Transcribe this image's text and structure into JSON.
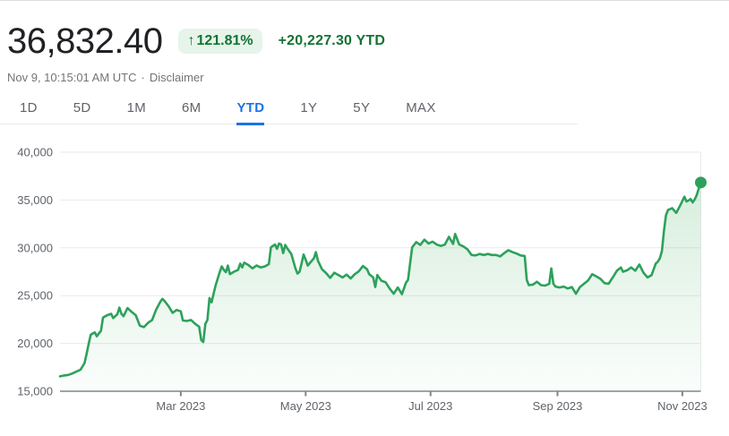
{
  "header": {
    "price": "36,832.40",
    "change_badge": {
      "arrow_icon": "↑",
      "percent": "121.81%"
    },
    "change_absolute": "+20,227.30 YTD",
    "timestamp": "Nov 9, 10:15:01 AM UTC",
    "separator": "·",
    "disclaimer_label": "Disclaimer"
  },
  "tabs": {
    "items": [
      {
        "label": "1D",
        "active": false
      },
      {
        "label": "5D",
        "active": false
      },
      {
        "label": "1M",
        "active": false
      },
      {
        "label": "6M",
        "active": false
      },
      {
        "label": "YTD",
        "active": true
      },
      {
        "label": "1Y",
        "active": false
      },
      {
        "label": "5Y",
        "active": false
      },
      {
        "label": "MAX",
        "active": false
      }
    ]
  },
  "colors": {
    "line_green": "#2da15b",
    "fill_green": "#34a853",
    "green_dark": "#137333",
    "badge_bg": "#e6f4ea",
    "blue": "#1a73e8",
    "grid": "#e8eaed",
    "axis": "#80868b",
    "tick_label": "#5f6368"
  },
  "chart_data": {
    "type": "area",
    "series_note": "price in USD, Jan 1 2023 (day 0) through Nov 9 2023 (day 313)",
    "ylim": [
      15000,
      40000
    ],
    "xlim_days": [
      0,
      313
    ],
    "grid": true,
    "y_ticks": [
      {
        "value": 15000,
        "label": "15,000"
      },
      {
        "value": 20000,
        "label": "20,000"
      },
      {
        "value": 25000,
        "label": "25,000"
      },
      {
        "value": 30000,
        "label": "30,000"
      },
      {
        "value": 35000,
        "label": "35,000"
      },
      {
        "value": 40000,
        "label": "40,000"
      }
    ],
    "x_ticks": [
      {
        "day": 59,
        "label": "Mar 2023"
      },
      {
        "day": 120,
        "label": "May 2023"
      },
      {
        "day": 181,
        "label": "Jul 2023"
      },
      {
        "day": 243,
        "label": "Sep 2023"
      },
      {
        "day": 304,
        "label": "Nov 2023"
      }
    ],
    "last_value": 36832.4,
    "points": [
      [
        0,
        16550
      ],
      [
        2,
        16650
      ],
      [
        4,
        16700
      ],
      [
        6,
        16850
      ],
      [
        8,
        17050
      ],
      [
        10,
        17250
      ],
      [
        12,
        17950
      ],
      [
        13,
        18900
      ],
      [
        14,
        19950
      ],
      [
        15,
        20900
      ],
      [
        16,
        21050
      ],
      [
        17,
        21150
      ],
      [
        18,
        20750
      ],
      [
        19,
        21050
      ],
      [
        20,
        21300
      ],
      [
        21,
        22700
      ],
      [
        23,
        22950
      ],
      [
        25,
        23100
      ],
      [
        26,
        22650
      ],
      [
        28,
        23050
      ],
      [
        29,
        23750
      ],
      [
        30,
        23100
      ],
      [
        31,
        22850
      ],
      [
        33,
        23700
      ],
      [
        35,
        23300
      ],
      [
        37,
        22950
      ],
      [
        39,
        21850
      ],
      [
        41,
        21700
      ],
      [
        43,
        22150
      ],
      [
        45,
        22450
      ],
      [
        47,
        23550
      ],
      [
        49,
        24350
      ],
      [
        50,
        24650
      ],
      [
        51,
        24450
      ],
      [
        53,
        23900
      ],
      [
        55,
        23200
      ],
      [
        57,
        23500
      ],
      [
        59,
        23350
      ],
      [
        60,
        22400
      ],
      [
        62,
        22350
      ],
      [
        64,
        22450
      ],
      [
        66,
        22050
      ],
      [
        68,
        21750
      ],
      [
        69,
        20350
      ],
      [
        70,
        20150
      ],
      [
        71,
        22050
      ],
      [
        72,
        22450
      ],
      [
        73,
        24750
      ],
      [
        74,
        24300
      ],
      [
        76,
        26050
      ],
      [
        78,
        27450
      ],
      [
        79,
        28050
      ],
      [
        80,
        27700
      ],
      [
        81,
        27450
      ],
      [
        82,
        28150
      ],
      [
        83,
        27250
      ],
      [
        85,
        27500
      ],
      [
        87,
        27700
      ],
      [
        88,
        28350
      ],
      [
        89,
        27950
      ],
      [
        90,
        28450
      ],
      [
        92,
        28200
      ],
      [
        94,
        27850
      ],
      [
        96,
        28150
      ],
      [
        98,
        27950
      ],
      [
        100,
        28050
      ],
      [
        102,
        28300
      ],
      [
        103,
        30050
      ],
      [
        105,
        30350
      ],
      [
        106,
        29900
      ],
      [
        107,
        30450
      ],
      [
        108,
        30350
      ],
      [
        109,
        29450
      ],
      [
        110,
        30300
      ],
      [
        111,
        29950
      ],
      [
        113,
        29350
      ],
      [
        115,
        27850
      ],
      [
        116,
        27300
      ],
      [
        117,
        27500
      ],
      [
        118,
        28350
      ],
      [
        119,
        29300
      ],
      [
        120,
        28750
      ],
      [
        121,
        28150
      ],
      [
        124,
        28900
      ],
      [
        125,
        29550
      ],
      [
        126,
        28650
      ],
      [
        128,
        27750
      ],
      [
        130,
        27350
      ],
      [
        132,
        26850
      ],
      [
        134,
        27400
      ],
      [
        136,
        27150
      ],
      [
        138,
        26900
      ],
      [
        140,
        27200
      ],
      [
        142,
        26800
      ],
      [
        144,
        27250
      ],
      [
        146,
        27550
      ],
      [
        148,
        28100
      ],
      [
        150,
        27750
      ],
      [
        151,
        27250
      ],
      [
        153,
        26900
      ],
      [
        154,
        25900
      ],
      [
        155,
        27150
      ],
      [
        157,
        26550
      ],
      [
        159,
        26400
      ],
      [
        161,
        25750
      ],
      [
        163,
        25200
      ],
      [
        165,
        25850
      ],
      [
        167,
        25150
      ],
      [
        169,
        26350
      ],
      [
        170,
        26650
      ],
      [
        171,
        28350
      ],
      [
        172,
        30050
      ],
      [
        174,
        30600
      ],
      [
        176,
        30300
      ],
      [
        178,
        30850
      ],
      [
        180,
        30450
      ],
      [
        182,
        30650
      ],
      [
        184,
        30350
      ],
      [
        186,
        30200
      ],
      [
        188,
        30350
      ],
      [
        190,
        31150
      ],
      [
        192,
        30400
      ],
      [
        193,
        31450
      ],
      [
        195,
        30350
      ],
      [
        197,
        30150
      ],
      [
        199,
        29850
      ],
      [
        201,
        29250
      ],
      [
        203,
        29200
      ],
      [
        205,
        29350
      ],
      [
        207,
        29250
      ],
      [
        209,
        29350
      ],
      [
        211,
        29250
      ],
      [
        213,
        29250
      ],
      [
        215,
        29100
      ],
      [
        217,
        29450
      ],
      [
        219,
        29750
      ],
      [
        221,
        29550
      ],
      [
        223,
        29400
      ],
      [
        225,
        29200
      ],
      [
        227,
        29150
      ],
      [
        228,
        26650
      ],
      [
        229,
        26100
      ],
      [
        231,
        26150
      ],
      [
        233,
        26450
      ],
      [
        235,
        26100
      ],
      [
        237,
        26050
      ],
      [
        239,
        26250
      ],
      [
        240,
        27850
      ],
      [
        241,
        26250
      ],
      [
        242,
        25950
      ],
      [
        244,
        25850
      ],
      [
        246,
        25950
      ],
      [
        248,
        25750
      ],
      [
        250,
        25900
      ],
      [
        252,
        25200
      ],
      [
        254,
        25900
      ],
      [
        256,
        26250
      ],
      [
        258,
        26600
      ],
      [
        260,
        27250
      ],
      [
        262,
        27000
      ],
      [
        264,
        26750
      ],
      [
        266,
        26300
      ],
      [
        268,
        26250
      ],
      [
        270,
        26900
      ],
      [
        272,
        27600
      ],
      [
        274,
        27950
      ],
      [
        275,
        27500
      ],
      [
        277,
        27650
      ],
      [
        279,
        27950
      ],
      [
        281,
        27600
      ],
      [
        283,
        28250
      ],
      [
        285,
        27400
      ],
      [
        287,
        26900
      ],
      [
        289,
        27150
      ],
      [
        291,
        28350
      ],
      [
        292,
        28550
      ],
      [
        293,
        28900
      ],
      [
        294,
        29650
      ],
      [
        295,
        31800
      ],
      [
        296,
        33400
      ],
      [
        297,
        33950
      ],
      [
        299,
        34150
      ],
      [
        301,
        33650
      ],
      [
        303,
        34450
      ],
      [
        305,
        35350
      ],
      [
        306,
        34850
      ],
      [
        307,
        34950
      ],
      [
        308,
        35100
      ],
      [
        309,
        34750
      ],
      [
        310,
        35050
      ],
      [
        311,
        35500
      ],
      [
        312,
        36200
      ],
      [
        313,
        36832
      ]
    ]
  }
}
